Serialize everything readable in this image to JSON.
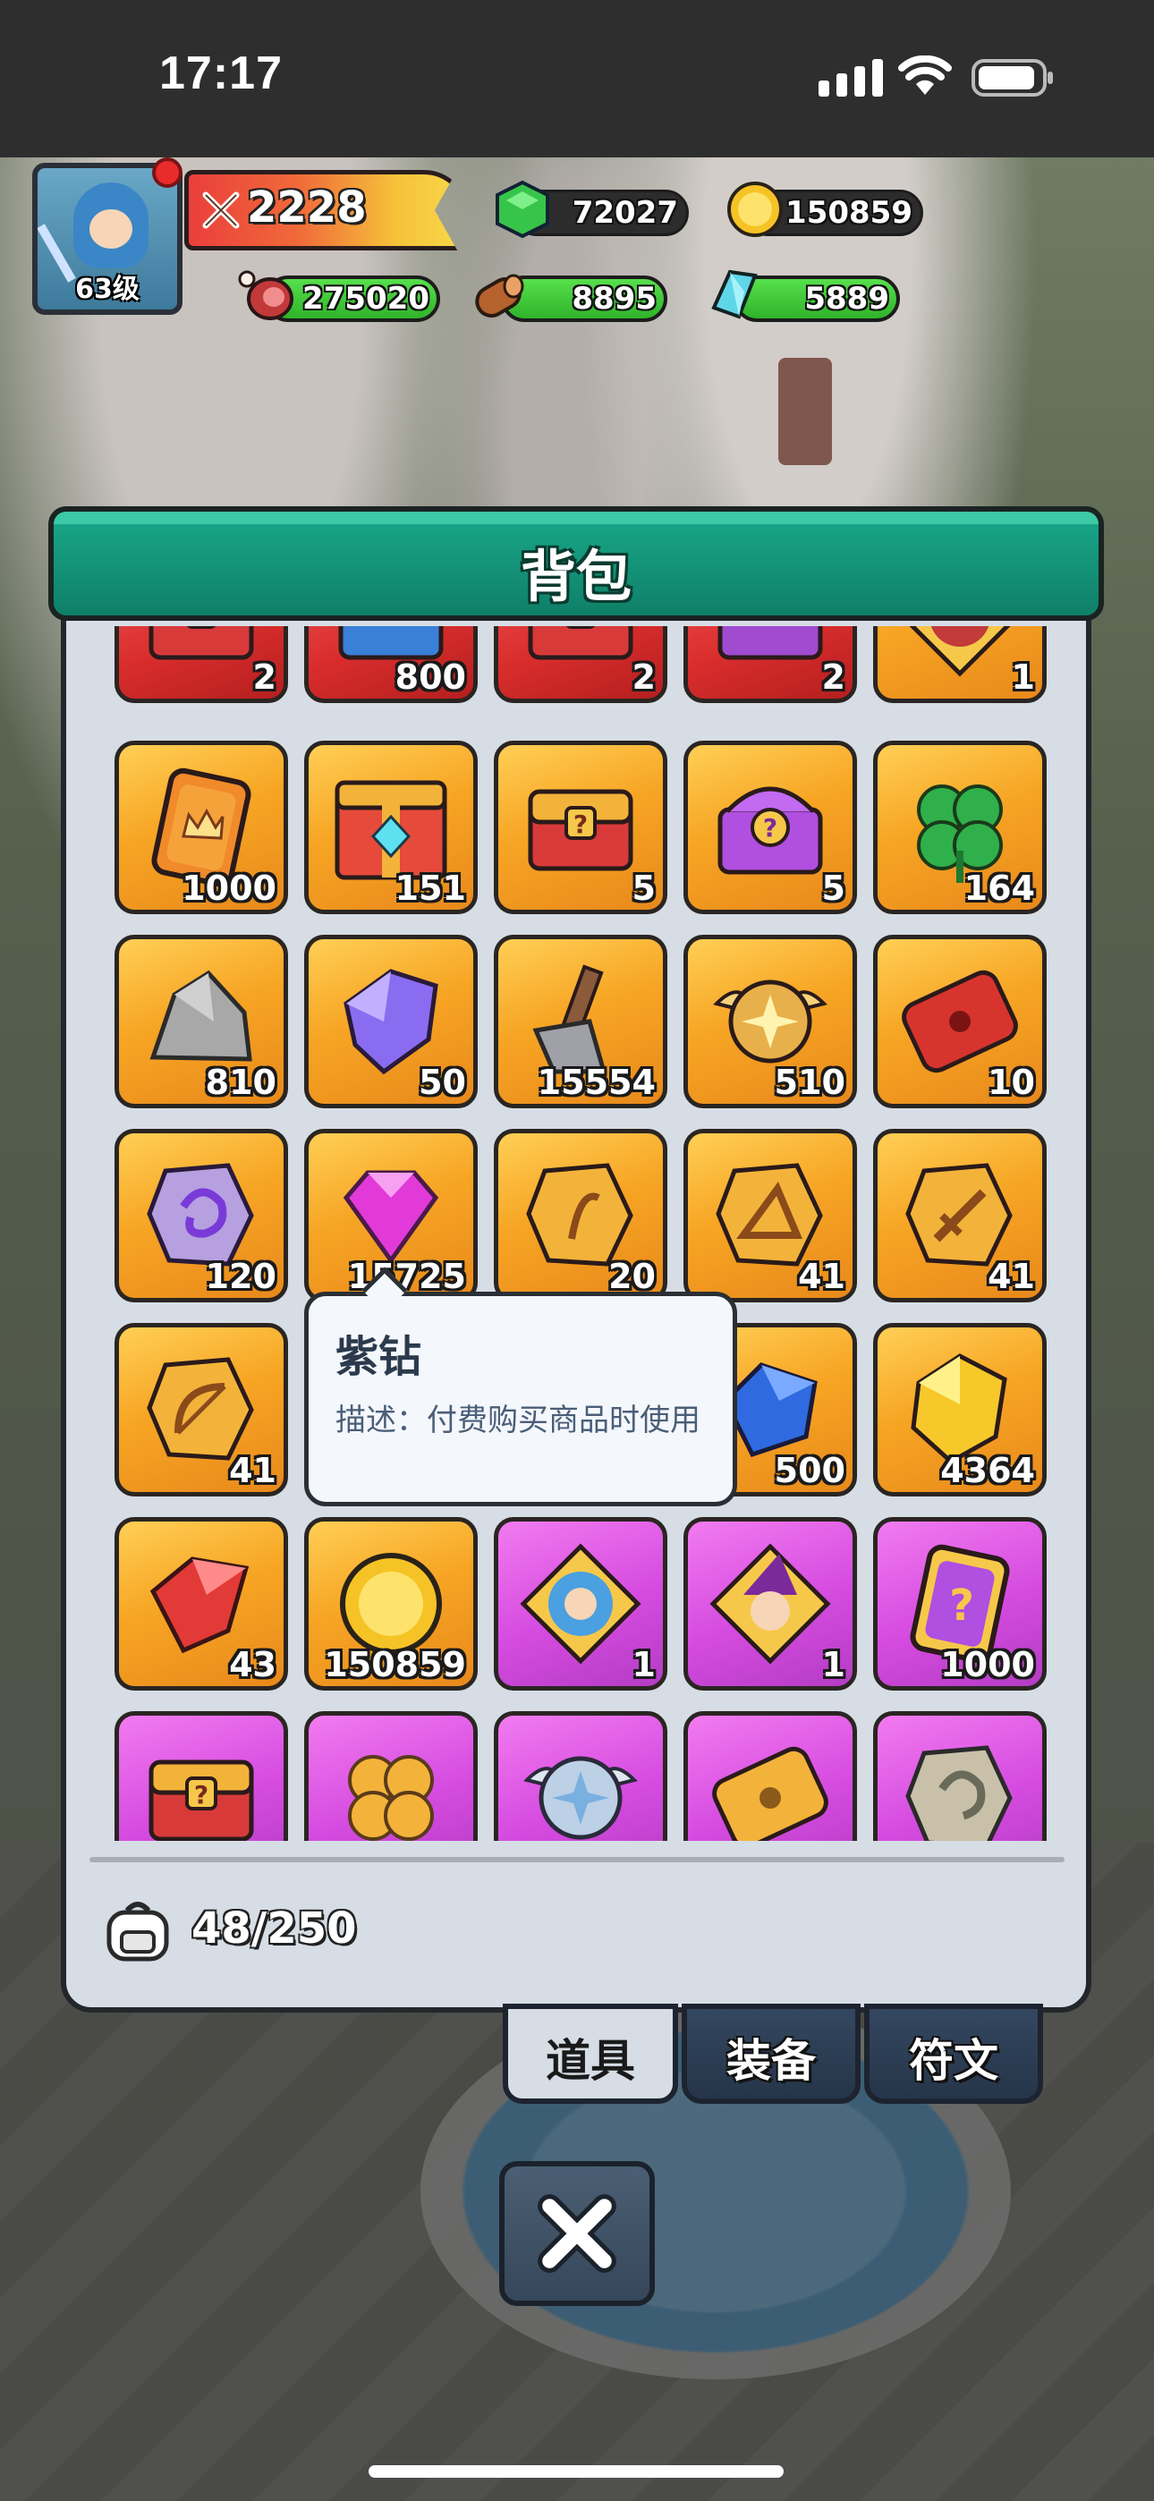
{
  "status_bar": {
    "time": "17:17"
  },
  "hud": {
    "level": "63级",
    "power": "2228",
    "emerald": "72027",
    "gold": "150859",
    "meat": "275020",
    "wood": "8895",
    "crystal": "5889"
  },
  "panel": {
    "title": "背包",
    "capacity": "48/250"
  },
  "grid_rows": [
    [
      {
        "item": "chest-question-icon",
        "color": "red",
        "count": "2"
      },
      {
        "item": "chest-blue-gem-icon",
        "color": "red",
        "count": "800"
      },
      {
        "item": "chest-question-icon",
        "color": "red",
        "count": "2"
      },
      {
        "item": "chest-purple-icon",
        "color": "red",
        "count": "2"
      },
      {
        "item": "hero-portrait-icon",
        "color": "orange",
        "count": "1"
      }
    ],
    [
      {
        "item": "crown-card-icon",
        "color": "orange",
        "count": "1000"
      },
      {
        "item": "chest-gold-gem-icon",
        "color": "orange",
        "count": "151"
      },
      {
        "item": "chest-question-icon",
        "color": "orange",
        "count": "5"
      },
      {
        "item": "chest-purple-question-icon",
        "color": "orange",
        "count": "5"
      },
      {
        "item": "four-leaf-clover-icon",
        "color": "orange",
        "count": "164"
      }
    ],
    [
      {
        "item": "stone-icon",
        "color": "orange",
        "count": "810"
      },
      {
        "item": "purple-crystal-icon",
        "color": "orange",
        "count": "50"
      },
      {
        "item": "hammer-icon",
        "color": "orange",
        "count": "15554"
      },
      {
        "item": "winged-medal-icon",
        "color": "orange",
        "count": "510"
      },
      {
        "item": "red-ticket-icon",
        "color": "orange",
        "count": "10"
      }
    ],
    [
      {
        "item": "purple-rune-stone-icon",
        "color": "orange",
        "count": "120"
      },
      {
        "item": "purple-diamond-icon",
        "color": "orange",
        "count": "15725"
      },
      {
        "item": "gold-rune-leaf-icon",
        "color": "orange",
        "count": "20"
      },
      {
        "item": "gold-rune-hat-icon",
        "color": "orange",
        "count": "41"
      },
      {
        "item": "gold-rune-sword-icon",
        "color": "orange",
        "count": "41"
      }
    ],
    [
      {
        "item": "gold-rune-bow-icon",
        "color": "orange",
        "count": "41"
      },
      {
        "item": "hidden",
        "color": "orange",
        "count": ""
      },
      {
        "item": "hidden",
        "color": "orange",
        "count": ""
      },
      {
        "item": "blue-gem-icon",
        "color": "orange",
        "count": "500"
      },
      {
        "item": "gold-gem-icon",
        "color": "orange",
        "count": "4364"
      }
    ],
    [
      {
        "item": "red-gem-icon",
        "color": "orange",
        "count": "43"
      },
      {
        "item": "gold-coin-icon",
        "color": "orange",
        "count": "150859"
      },
      {
        "item": "blue-hero-card-icon",
        "color": "purple",
        "count": "1"
      },
      {
        "item": "witch-hero-card-icon",
        "color": "purple",
        "count": "1"
      },
      {
        "item": "question-card-icon",
        "color": "purple",
        "count": "1000"
      }
    ],
    [
      {
        "item": "chest-question-icon",
        "color": "purple",
        "count": ""
      },
      {
        "item": "gold-clover-icon",
        "color": "purple",
        "count": ""
      },
      {
        "item": "silver-winged-medal-icon",
        "color": "purple",
        "count": ""
      },
      {
        "item": "gold-ticket-icon",
        "color": "purple",
        "count": ""
      },
      {
        "item": "grey-rune-stone-icon",
        "color": "purple",
        "count": ""
      }
    ]
  ],
  "tooltip": {
    "title": "紫钻",
    "description": "描述：付费购买商品时使用"
  },
  "tabs": [
    {
      "label": "道具",
      "active": true
    },
    {
      "label": "装备",
      "active": false
    },
    {
      "label": "符文",
      "active": false
    }
  ]
}
